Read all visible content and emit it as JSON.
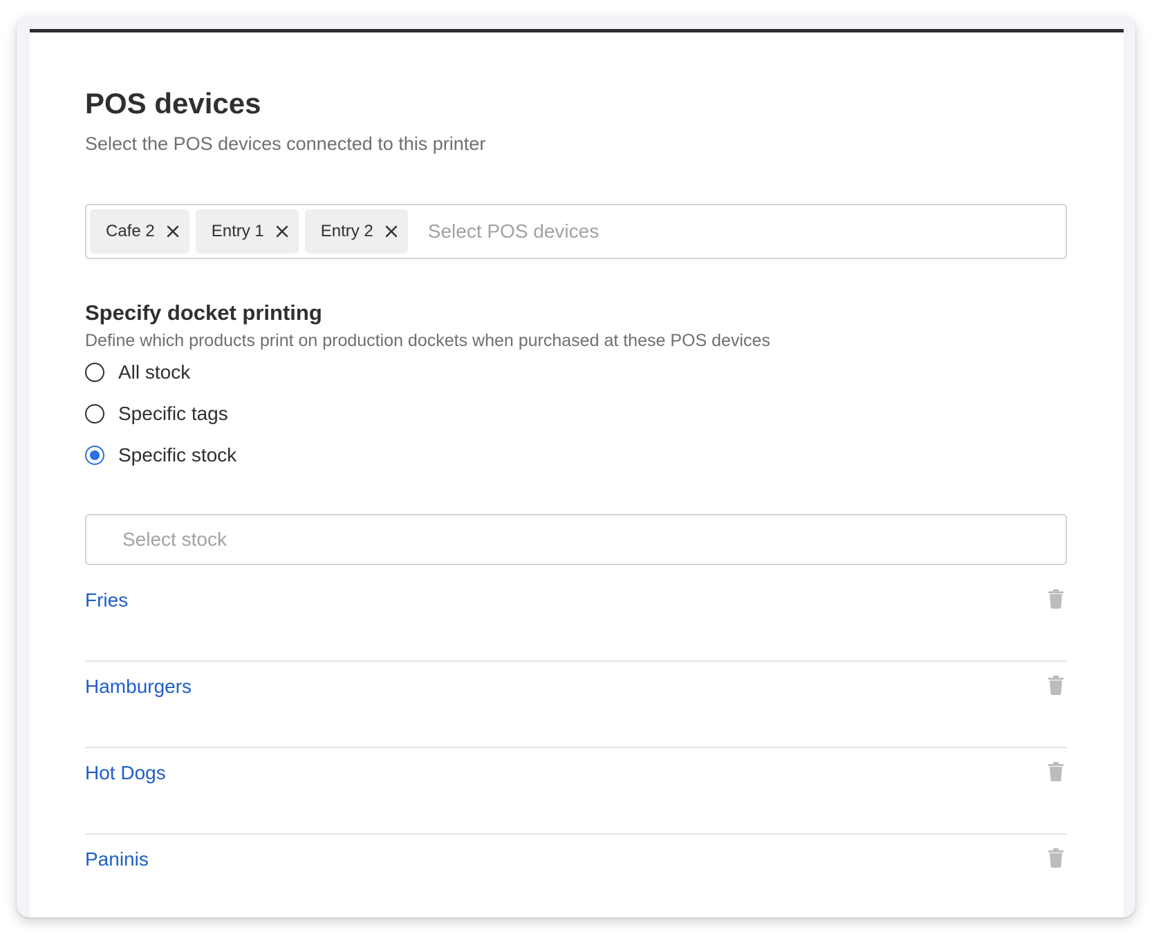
{
  "pos_section": {
    "title": "POS devices",
    "subtitle": "Select the POS devices connected to this printer",
    "selected_devices": [
      {
        "label": "Cafe 2"
      },
      {
        "label": "Entry 1"
      },
      {
        "label": "Entry 2"
      }
    ],
    "placeholder": "Select POS devices"
  },
  "docket_section": {
    "title": "Specify docket printing",
    "subtitle": "Define which products print on production dockets when purchased at these POS devices",
    "options": [
      {
        "label": "All stock",
        "checked": false
      },
      {
        "label": "Specific tags",
        "checked": false
      },
      {
        "label": "Specific stock",
        "checked": true
      }
    ],
    "stock_placeholder": "Select stock",
    "stock_items": [
      {
        "name": "Fries"
      },
      {
        "name": "Hamburgers"
      },
      {
        "name": "Hot Dogs"
      },
      {
        "name": "Paninis"
      }
    ]
  },
  "colors": {
    "accent": "#2a6fe0",
    "link": "#1e5ec8",
    "top_bar": "#2b2b2d"
  },
  "icons": {
    "chip_remove": "close-icon",
    "stock_remove": "trash-icon"
  }
}
